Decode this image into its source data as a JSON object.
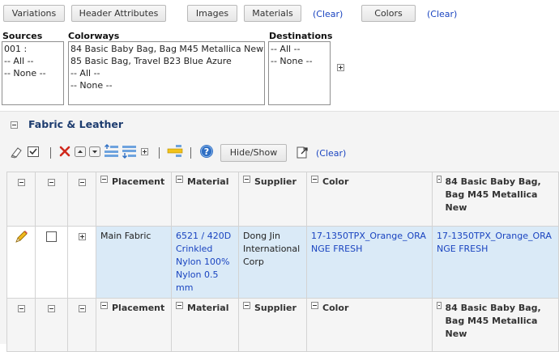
{
  "top_buttons": {
    "variations": "Variations",
    "header_attributes": "Header Attributes",
    "images": "Images",
    "materials": "Materials",
    "materials_clear": "(Clear)",
    "colors": "Colors",
    "colors_clear": "(Clear)"
  },
  "filters": {
    "sources_label": "Sources",
    "sources_items": [
      "001 :",
      "-- All --",
      "-- None --"
    ],
    "colorways_label": "Colorways",
    "colorways_items": [
      "84 Basic Baby Bag, Bag M45 Metallica New",
      "85 Basic Bag, Travel B23 Blue Azure",
      "-- All --",
      "-- None --"
    ],
    "destinations_label": "Destinations",
    "destinations_items": [
      "-- All --",
      "-- None --"
    ]
  },
  "section": {
    "title": "Fabric & Leather"
  },
  "toolbar": {
    "hide_show_label": "Hide/Show",
    "clear_label": "(Clear)"
  },
  "table": {
    "columns": [
      "Placement",
      "Material",
      "Supplier",
      "Color",
      "84 Basic Baby Bag, Bag M45 Metallica New"
    ],
    "rows": [
      {
        "placement": "Main Fabric",
        "material": "6521 / 420D Crinkled Nylon 100% Nylon 0.5 mm",
        "supplier": "Dong Jin International Corp",
        "color": "17-1350TPX_Orange_ORANGE FRESH",
        "colorway_color": "17-1350TPX_Orange_ORANGE FRESH"
      }
    ]
  },
  "colors": {
    "link": "#1a44c0",
    "section_title": "#1d3c6f",
    "row_highlight": "#daeaf7",
    "delete_red": "#d0281c",
    "help_blue": "#2f6fc4"
  }
}
